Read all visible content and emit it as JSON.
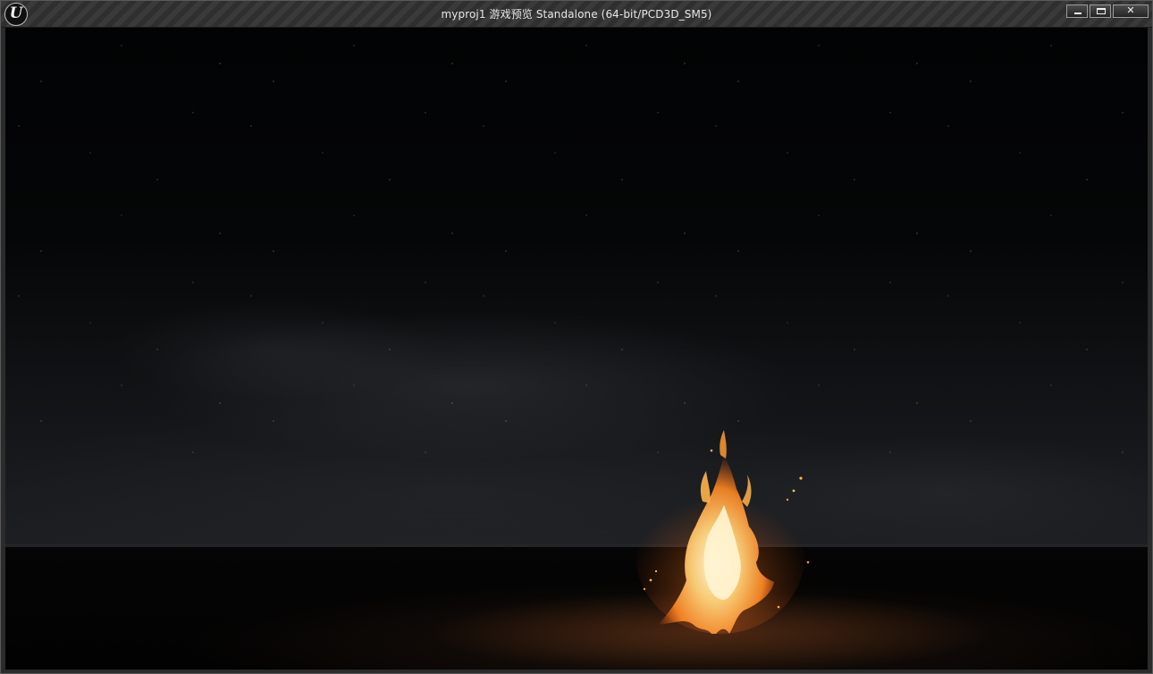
{
  "window": {
    "title": "myproj1 游戏预览 Standalone (64-bit/PCD3D_SM5)",
    "app_logo_text": "U",
    "controls": {
      "close_label": "✕"
    }
  },
  "viewport": {
    "scene": "night-sky-with-campfire"
  },
  "colors": {
    "titlebar": "#333333",
    "title_text": "#e6e6e6",
    "fire_core": "#fff2c8",
    "fire_outer": "#ff7a1a"
  }
}
